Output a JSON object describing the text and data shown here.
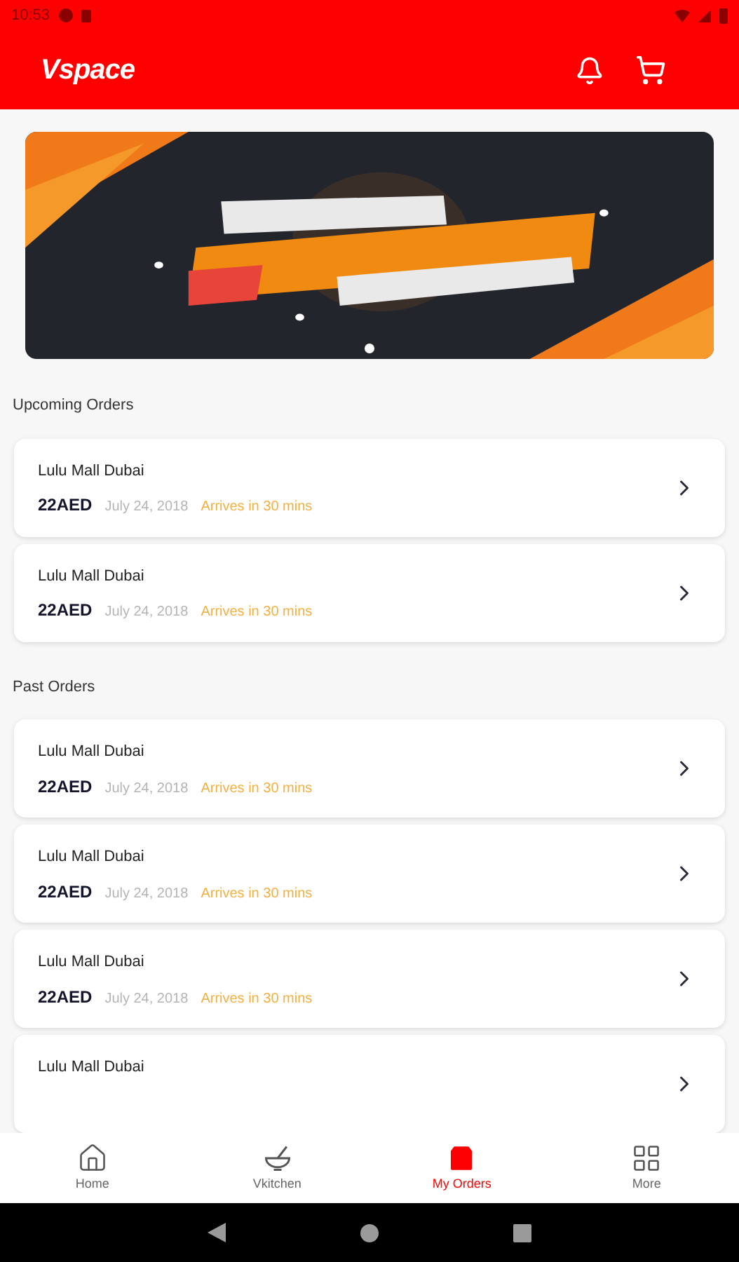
{
  "status_bar": {
    "time": "10:53"
  },
  "header": {
    "logo": "Vspace"
  },
  "banner": {
    "kind": "picture",
    "dots": [
      {
        "selected": true
      }
    ]
  },
  "sections": [
    {
      "title": "Upcoming Orders",
      "orders": [
        {
          "title": "Lulu Mall Dubai",
          "amount": "22AED",
          "date": "July 24, 2018",
          "status": "Arrives in 30 mins"
        },
        {
          "title": "Lulu Mall Dubai",
          "amount": "22AED",
          "date": "July 24, 2018",
          "status": "Arrives in 30 mins"
        }
      ]
    },
    {
      "title": "Past Orders",
      "orders": [
        {
          "title": "Lulu Mall Dubai",
          "amount": "22AED",
          "date": "July 24, 2018",
          "status": "Arrives in 30 mins"
        },
        {
          "title": "Lulu Mall Dubai",
          "amount": "22AED",
          "date": "July 24, 2018",
          "status": "Arrives in 30 mins"
        },
        {
          "title": "Lulu Mall Dubai",
          "amount": "22AED",
          "date": "July 24, 2018",
          "status": "Arrives in 30 mins"
        },
        {
          "title": "Lulu Mall Dubai"
        }
      ]
    }
  ],
  "bottom_nav": [
    {
      "kind": "home",
      "label": "Home",
      "selected": false
    },
    {
      "kind": "kitchen",
      "label": "Vkitchen",
      "selected": false
    },
    {
      "kind": "orders",
      "label": "My Orders",
      "selected": true
    },
    {
      "kind": "more",
      "label": "More",
      "selected": false
    }
  ]
}
